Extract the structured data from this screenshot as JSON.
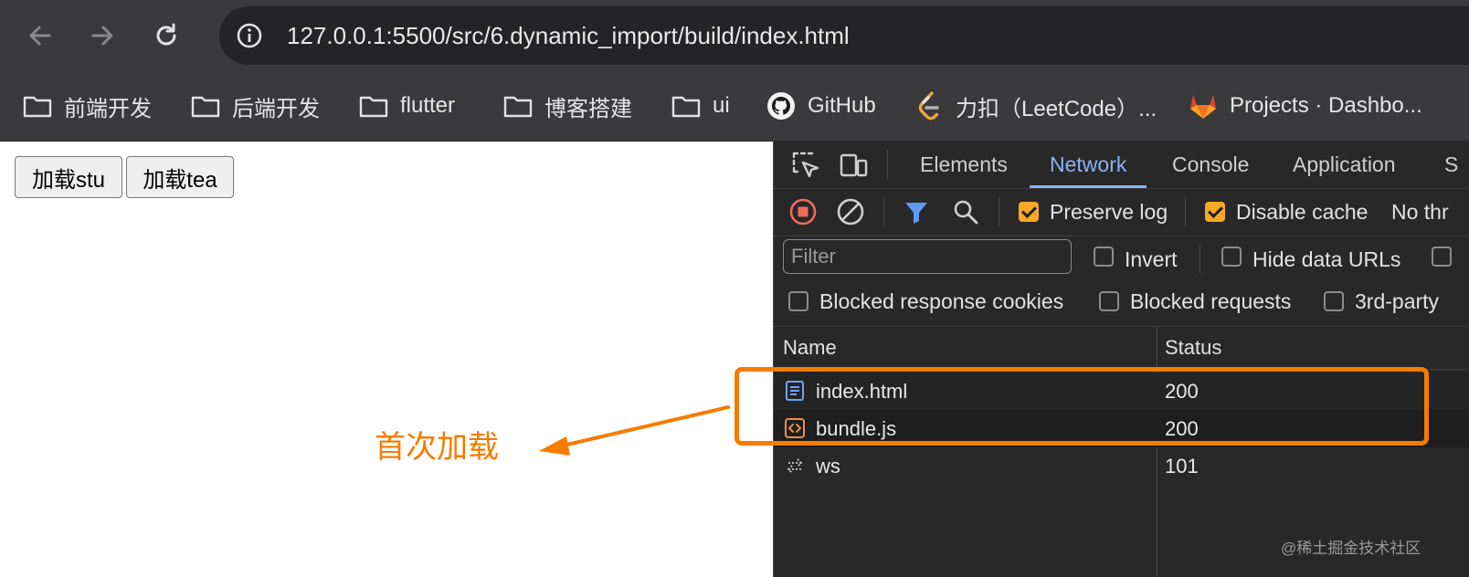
{
  "browser": {
    "url": "127.0.0.1:5500/src/6.dynamic_import/build/index.html",
    "nav": {
      "back": "back-icon",
      "forward": "forward-icon",
      "reload": "reload-icon"
    }
  },
  "bookmarks": [
    {
      "label": "前端开发",
      "icon": "folder-icon"
    },
    {
      "label": "后端开发",
      "icon": "folder-icon"
    },
    {
      "label": "flutter",
      "icon": "folder-icon"
    },
    {
      "label": "博客搭建",
      "icon": "folder-icon"
    },
    {
      "label": "ui",
      "icon": "folder-icon"
    },
    {
      "label": "GitHub",
      "icon": "github-icon"
    },
    {
      "label": "力扣（LeetCode）...",
      "icon": "leetcode-icon"
    },
    {
      "label": "Projects · Dashbo...",
      "icon": "gitlab-icon"
    }
  ],
  "page": {
    "buttons": [
      "加载stu",
      "加载tea"
    ]
  },
  "annotation": {
    "text": "首次加载",
    "color": "#f57c00"
  },
  "devtools": {
    "tabs": [
      {
        "label": "Elements",
        "active": false
      },
      {
        "label": "Network",
        "active": true
      },
      {
        "label": "Console",
        "active": false
      },
      {
        "label": "Application",
        "active": false
      },
      {
        "label": "S",
        "active": false
      }
    ],
    "toolbar": {
      "preserve_log": "Preserve log",
      "disable_cache": "Disable cache",
      "throttling": "No thr"
    },
    "filter": {
      "placeholder": "Filter",
      "invert": "Invert",
      "hide_data_urls": "Hide data URLs"
    },
    "filter2": {
      "blocked_cookies": "Blocked response cookies",
      "blocked_requests": "Blocked requests",
      "third_party": "3rd-party"
    },
    "table": {
      "columns": [
        "Name",
        "Status"
      ],
      "rows": [
        {
          "name": "index.html",
          "status": "200",
          "icon": "document-icon"
        },
        {
          "name": "bundle.js",
          "status": "200",
          "icon": "script-icon"
        },
        {
          "name": "ws",
          "status": "101",
          "icon": "websocket-icon"
        }
      ]
    }
  },
  "watermark": "@稀土掘金技术社区"
}
